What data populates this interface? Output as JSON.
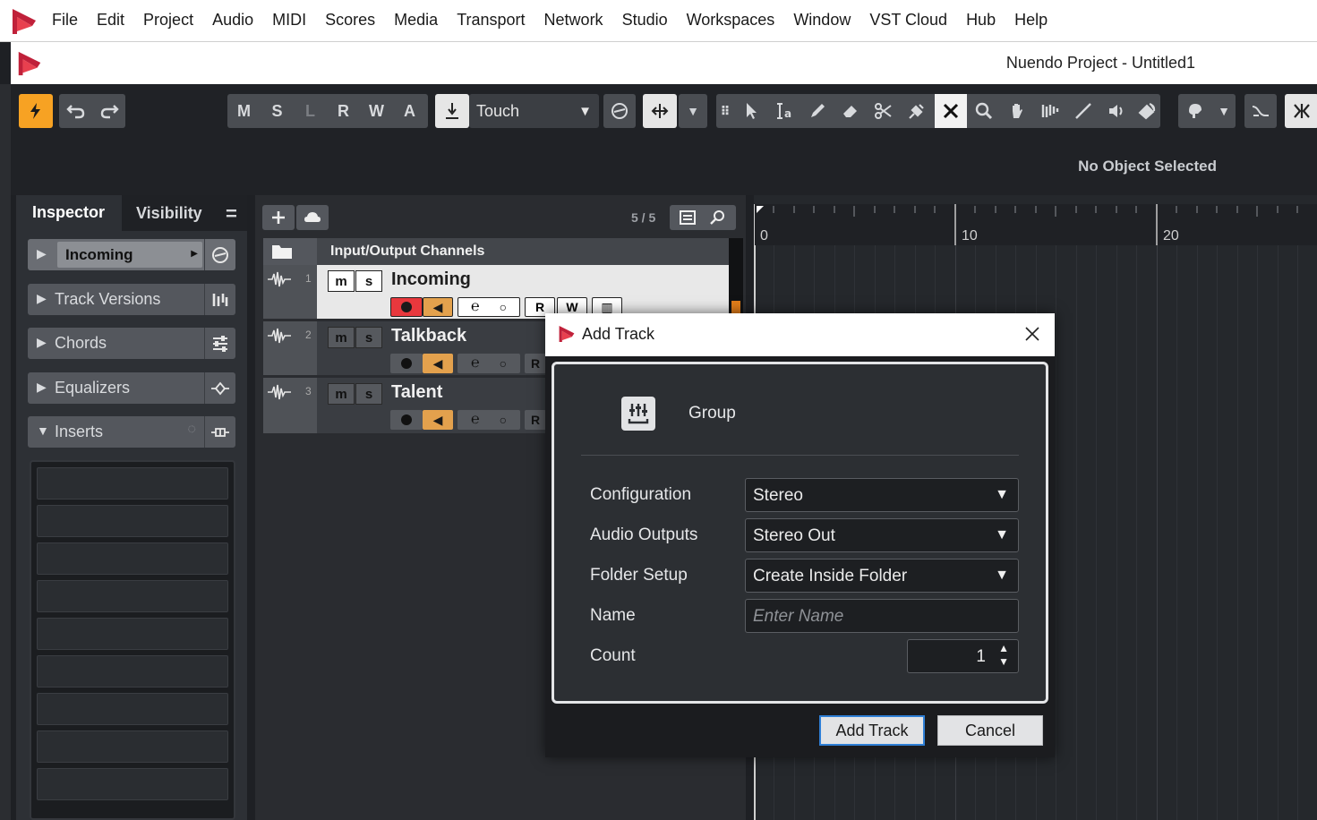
{
  "menubar": {
    "items": [
      "File",
      "Edit",
      "Project",
      "Audio",
      "MIDI",
      "Scores",
      "Media",
      "Transport",
      "Network",
      "Studio",
      "Workspaces",
      "Window",
      "VST Cloud",
      "Hub",
      "Help"
    ]
  },
  "window": {
    "title": "Nuendo Project - Untitled1"
  },
  "toolbar": {
    "automation_modes": [
      "M",
      "S",
      "L",
      "R",
      "W",
      "A"
    ],
    "automation_mode_value": "Touch"
  },
  "infoline": {
    "status": "No Object Selected"
  },
  "inspector": {
    "tabs": [
      "Inspector",
      "Visibility"
    ],
    "menu_glyph": "=",
    "sections": [
      {
        "label": "Incoming",
        "icon": "edit-e-icon"
      },
      {
        "label": "Track Versions",
        "icon": "track-versions-icon"
      },
      {
        "label": "Chords",
        "icon": "chord-sliders-icon"
      },
      {
        "label": "Equalizers",
        "icon": "eq-curve-icon"
      },
      {
        "label": "Inserts",
        "icon": "inserts-icon"
      }
    ]
  },
  "tracklist": {
    "count": "5 / 5",
    "folder_name": "Input/Output Channels",
    "tracks": [
      {
        "number": "1",
        "name": "Incoming",
        "mute": "m",
        "solo": "s",
        "read": "R",
        "write": "W"
      },
      {
        "number": "2",
        "name": "Talkback",
        "mute": "m",
        "solo": "s",
        "read": "R"
      },
      {
        "number": "3",
        "name": "Talent",
        "mute": "m",
        "solo": "s",
        "read": "R"
      }
    ]
  },
  "ruler": {
    "marks": [
      "0",
      "10",
      "20"
    ]
  },
  "dialog": {
    "title": "Add Track",
    "track_type": "Group",
    "fields": {
      "configuration": {
        "label": "Configuration",
        "value": "Stereo"
      },
      "audio_outputs": {
        "label": "Audio Outputs",
        "value": "Stereo Out"
      },
      "folder_setup": {
        "label": "Folder Setup",
        "value": "Create Inside Folder"
      },
      "name": {
        "label": "Name",
        "placeholder": "Enter Name"
      },
      "count": {
        "label": "Count",
        "value": "1"
      }
    },
    "buttons": {
      "add": "Add Track",
      "cancel": "Cancel"
    }
  },
  "colors": {
    "record": "#e8383d",
    "monitor": "#e3a14d",
    "accent": "#f7a223",
    "brand": "#c0213a"
  }
}
